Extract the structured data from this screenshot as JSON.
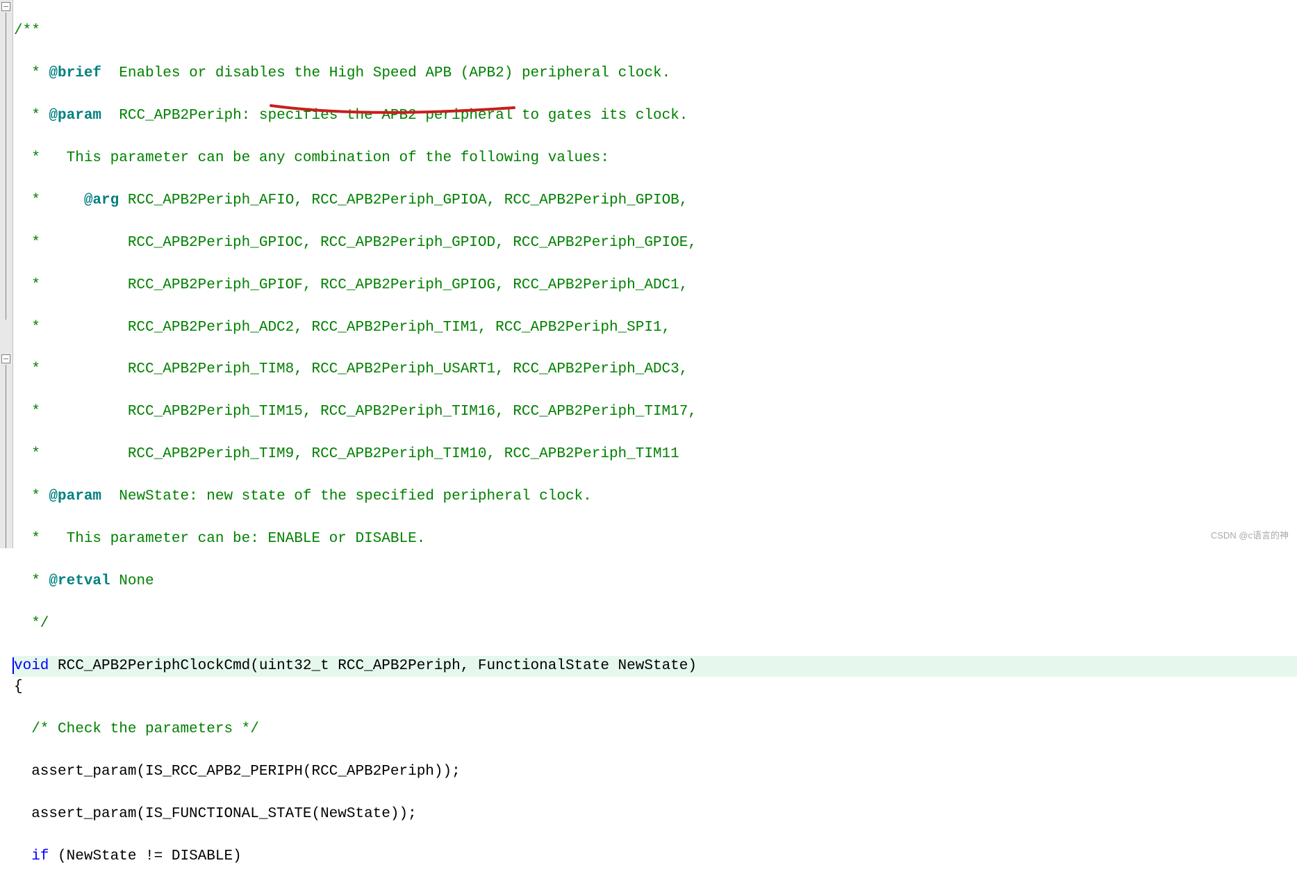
{
  "lines": {
    "l1": "/**",
    "l2a": "  * ",
    "l2b": "@brief",
    "l2c": "  Enables or disables the High Speed APB (APB2) peripheral clock.",
    "l3a": "  * ",
    "l3b": "@param",
    "l3c": "  RCC_APB2Periph: specifies the APB2 peripheral to gates its clock.",
    "l4": "  *   This parameter can be any combination of the following values:",
    "l5a": "  *     ",
    "l5b": "@arg",
    "l5c": " RCC_APB2Periph_AFIO, RCC_APB2Periph_GPIOA, RCC_APB2Periph_GPIOB,",
    "l6": "  *          RCC_APB2Periph_GPIOC, RCC_APB2Periph_GPIOD, RCC_APB2Periph_GPIOE,",
    "l7": "  *          RCC_APB2Periph_GPIOF, RCC_APB2Periph_GPIOG, RCC_APB2Periph_ADC1,",
    "l8": "  *          RCC_APB2Periph_ADC2, RCC_APB2Periph_TIM1, RCC_APB2Periph_SPI1,",
    "l9": "  *          RCC_APB2Periph_TIM8, RCC_APB2Periph_USART1, RCC_APB2Periph_ADC3,",
    "l10": "  *          RCC_APB2Periph_TIM15, RCC_APB2Periph_TIM16, RCC_APB2Periph_TIM17,",
    "l11": "  *          RCC_APB2Periph_TIM9, RCC_APB2Periph_TIM10, RCC_APB2Periph_TIM11",
    "l12a": "  * ",
    "l12b": "@param",
    "l12c": "  NewState: new state of the specified peripheral clock.",
    "l13": "  *   This parameter can be: ENABLE or DISABLE.",
    "l14a": "  * ",
    "l14b": "@retval",
    "l14c": " None",
    "l15": "  */",
    "l16a": "void",
    "l16b": " RCC_APB2PeriphClockCmd(uint32_t RCC_APB2Periph, FunctionalState NewState)",
    "l17": "{",
    "l18": "  /* Check the parameters */",
    "l19": "  assert_param(IS_RCC_APB2_PERIPH(RCC_APB2Periph));",
    "l20": "  assert_param(IS_FUNCTIONAL_STATE(NewState));",
    "l21a": "  ",
    "l21b": "if",
    "l21c": " (NewState != DISABLE)"
  },
  "watermark": "CSDN @c语言的神",
  "colors": {
    "comment": "#008000",
    "tag": "#008080",
    "keyword": "#0000ff",
    "highlight_bg": "#e6f7ed",
    "annotation": "#c91d1d"
  }
}
